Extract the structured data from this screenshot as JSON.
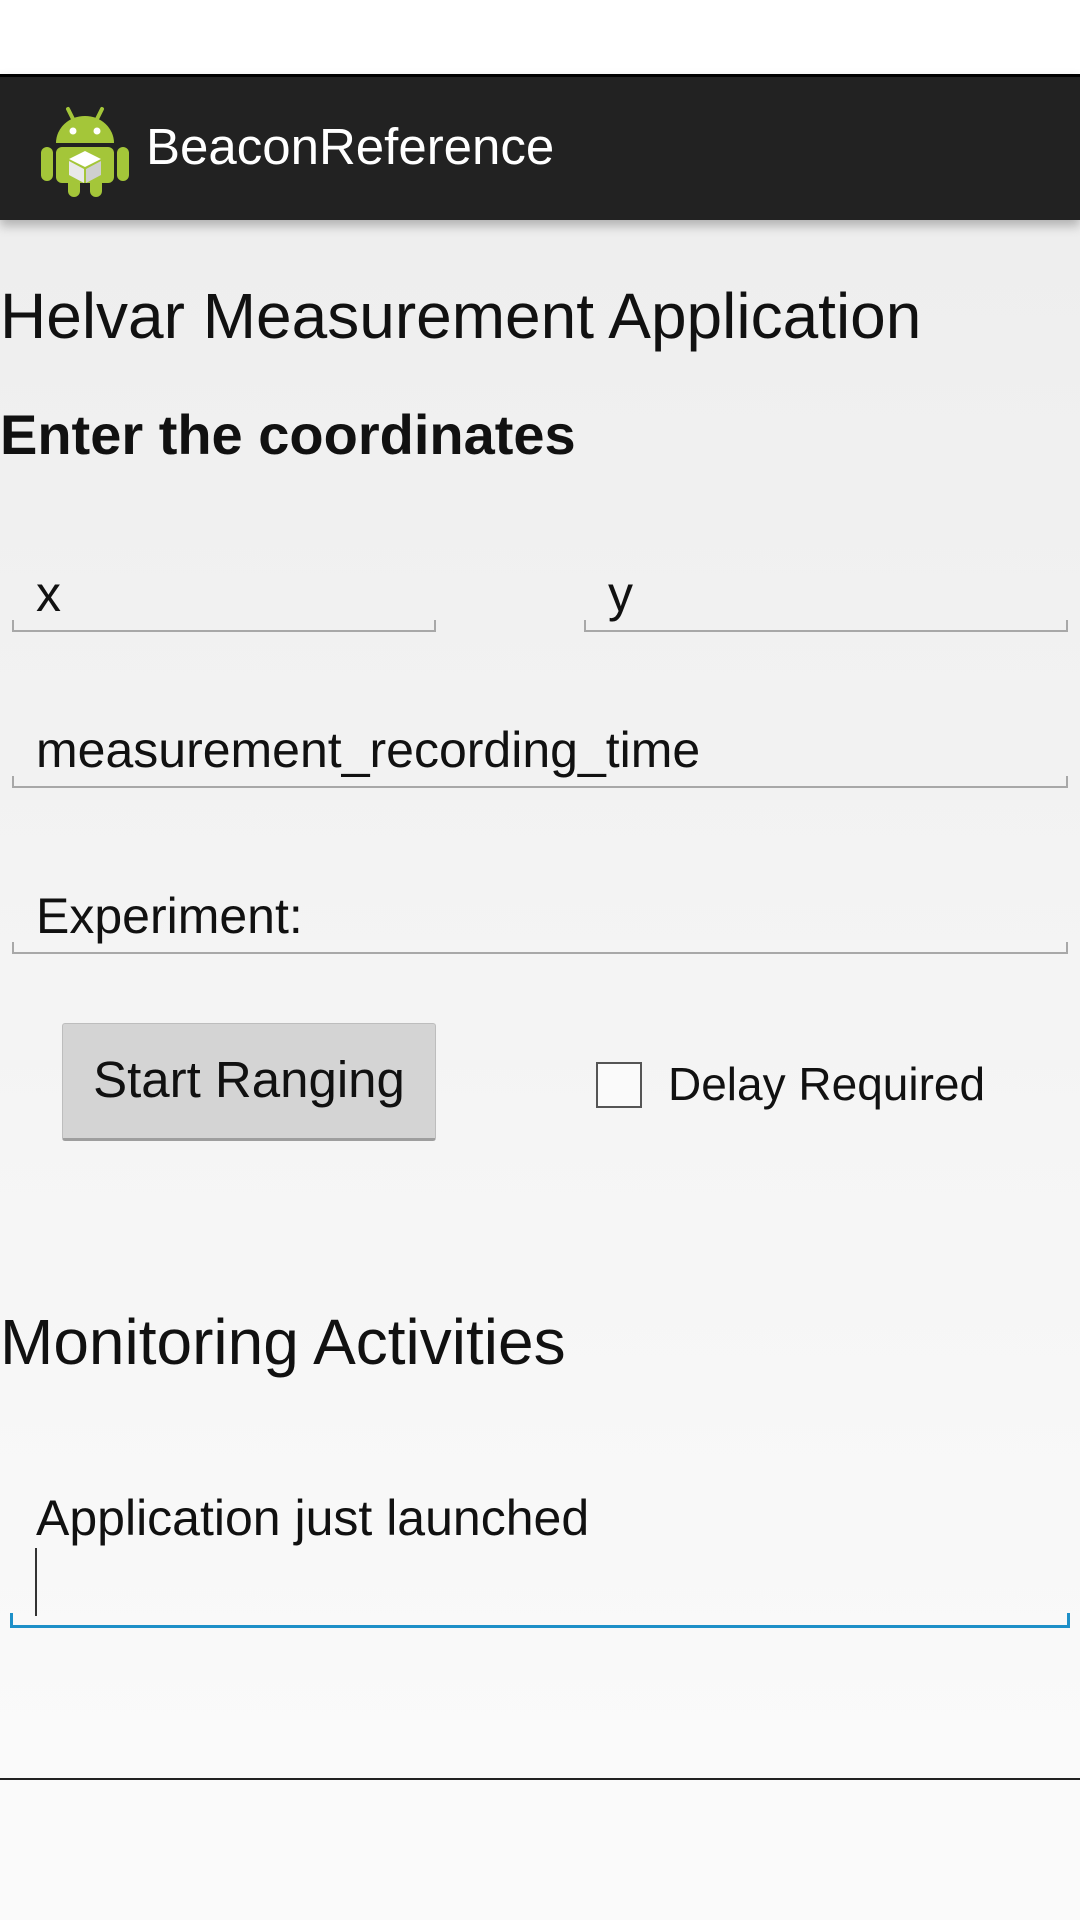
{
  "app": {
    "title": "BeaconReference",
    "icon": "android-robot-icon"
  },
  "main": {
    "heading": "Helvar Measurement Application",
    "coordinates_label": "Enter the coordinates",
    "x_field": {
      "value": "x"
    },
    "y_field": {
      "value": "y"
    },
    "recording_time_field": {
      "value": "measurement_recording_time"
    },
    "experiment_field": {
      "value": "Experiment:"
    },
    "start_button_label": "Start Ranging",
    "delay_checkbox": {
      "label": "Delay Required",
      "checked": false
    },
    "monitoring_heading": "Monitoring Activities",
    "log_field": {
      "value": "Application just launched"
    }
  },
  "colors": {
    "action_bar": "#222222",
    "focus_underline": "#1e90c8",
    "android_green": "#a4c639"
  }
}
